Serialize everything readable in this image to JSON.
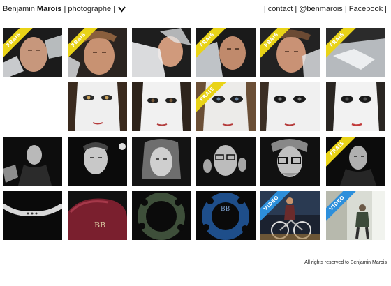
{
  "header": {
    "first_name": "Benjamin",
    "last_name": "Marois",
    "separator": "|",
    "role": "photographe",
    "nav": [
      {
        "label": "contact"
      },
      {
        "label": "@benmarois"
      },
      {
        "label": "Facebook"
      }
    ]
  },
  "ribbons": {
    "frais": "FRAIS",
    "video": "VIDEO"
  },
  "colors": {
    "ribbon_frais": "#e9d317",
    "ribbon_video": "#2d8fdb"
  },
  "footer": {
    "copyright": "All rights reserved to Benjamin Marois"
  }
}
